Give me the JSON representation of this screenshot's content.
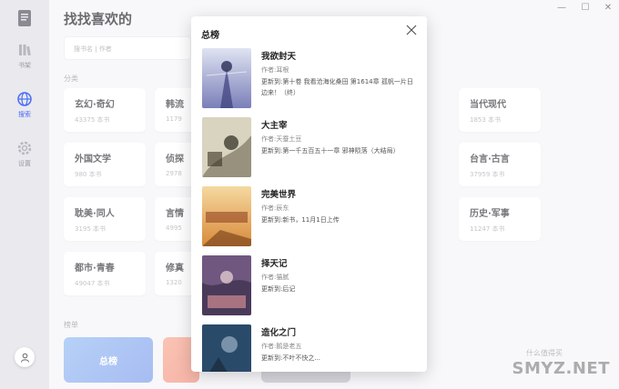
{
  "sidebar": {
    "items": [
      {
        "label": "书架",
        "icon": "bookshelf-icon"
      },
      {
        "label": "搜索",
        "icon": "globe-icon"
      },
      {
        "label": "设置",
        "icon": "gear-icon"
      }
    ]
  },
  "main": {
    "title": "找找喜欢的",
    "search_placeholder": "搜书名 | 作者",
    "category_label": "分类",
    "categories": [
      {
        "name": "玄幻·奇幻",
        "count": "43375 本书"
      },
      {
        "name": "韩流",
        "count": "1179"
      },
      {
        "name": "当代现代",
        "count": "1853 本书"
      },
      {
        "name": "外国文学",
        "count": "980 本书"
      },
      {
        "name": "侦探",
        "count": "2978"
      },
      {
        "name": "台言·古言",
        "count": "37959 本书"
      },
      {
        "name": "耽美·同人",
        "count": "3195 本书"
      },
      {
        "name": "言情",
        "count": "4995"
      },
      {
        "name": "历史·军事",
        "count": "11247 本书"
      },
      {
        "name": "都市·青春",
        "count": "49047 本书"
      },
      {
        "name": "修真",
        "count": "1320"
      }
    ],
    "rank_label": "榜单",
    "rank_cards": [
      {
        "label": "总榜",
        "color": "#7fa0f0"
      },
      {
        "label": "",
        "color": "#f4a08a"
      },
      {
        "label": "",
        "color": "#c9c9d0"
      }
    ]
  },
  "modal": {
    "title": "总榜",
    "books": [
      {
        "title": "我欲封天",
        "author": "作者:耳根",
        "update": "更新到:第十卷 我看沧海化桑田 第1614章 孤帆一片日边来！（终）",
        "cover_color": "#9aa2c8"
      },
      {
        "title": "大主宰",
        "author": "作者:天蚕土豆",
        "update": "更新到:第一千五百五十一章 邪神陨落（大结局）",
        "cover_color": "#c8c2a8"
      },
      {
        "title": "完美世界",
        "author": "作者:辰东",
        "update": "更新到:新书，11月1日上传",
        "cover_color": "#e8b060"
      },
      {
        "title": "择天记",
        "author": "作者:猫腻",
        "update": "更新到:后记",
        "cover_color": "#5a4a6a"
      },
      {
        "title": "造化之门",
        "author": "作者:鹅是老五",
        "update": "更新到:不叶不快之...",
        "cover_color": "#3a5a7a"
      }
    ]
  },
  "watermark": {
    "text": "SMYZ.NET",
    "sub": "什么值得买"
  }
}
